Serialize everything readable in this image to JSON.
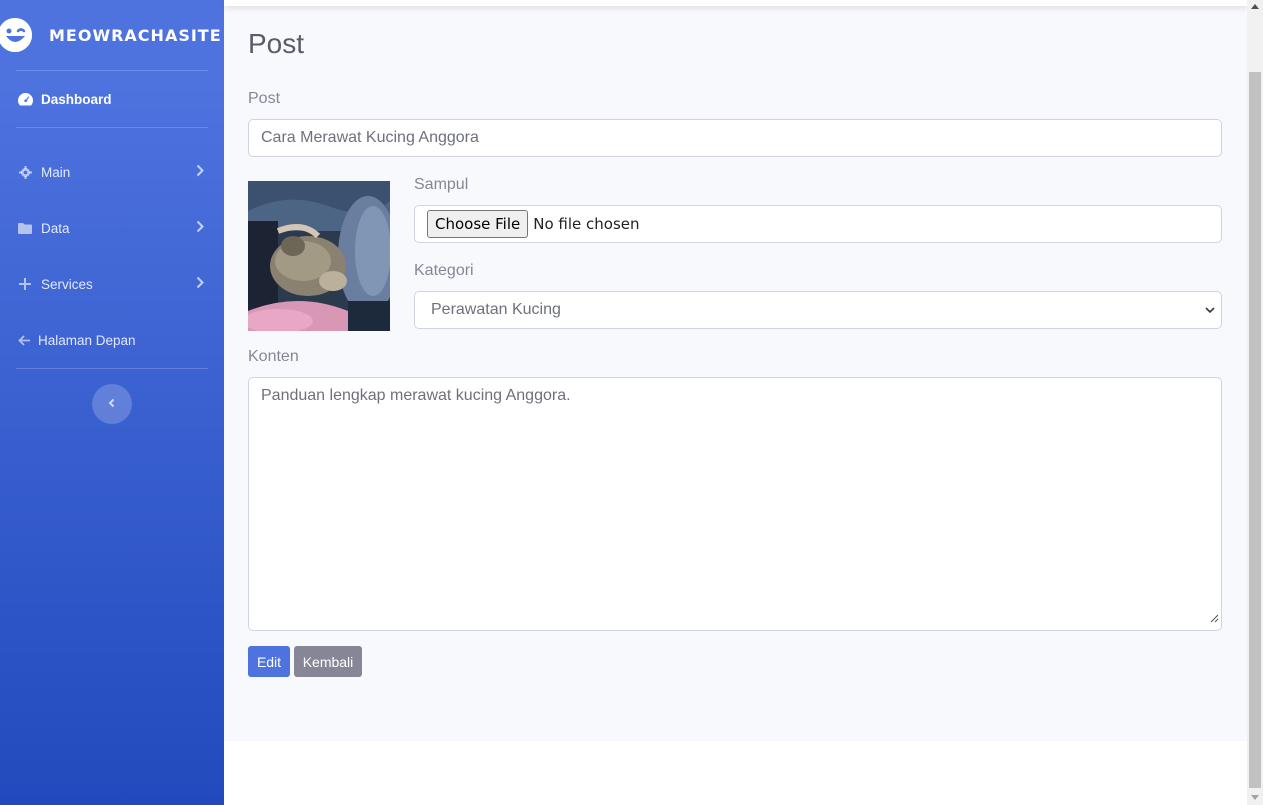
{
  "sidebar": {
    "brand": "MEOWRACHASITE",
    "items": [
      {
        "label": "Dashboard",
        "icon": "tachometer-icon"
      },
      {
        "label": "Main",
        "icon": "gear-icon"
      },
      {
        "label": "Data",
        "icon": "folder-icon"
      },
      {
        "label": "Services",
        "icon": "plus-icon"
      },
      {
        "label": "Halaman Depan",
        "icon": "arrow-left-icon"
      }
    ]
  },
  "page": {
    "title": "Post"
  },
  "form": {
    "post_label": "Post",
    "post_value": "Cara Merawat Kucing Anggora",
    "sampul_label": "Sampul",
    "file_button": "Choose File",
    "file_status": "No file chosen",
    "kategori_label": "Kategori",
    "kategori_value": "Perawatan Kucing",
    "konten_label": "Konten",
    "konten_value": "Panduan lengkap merawat kucing Anggora.",
    "edit_button": "Edit",
    "back_button": "Kembali"
  },
  "colors": {
    "primary": "#4e73df",
    "secondary": "#858796"
  }
}
